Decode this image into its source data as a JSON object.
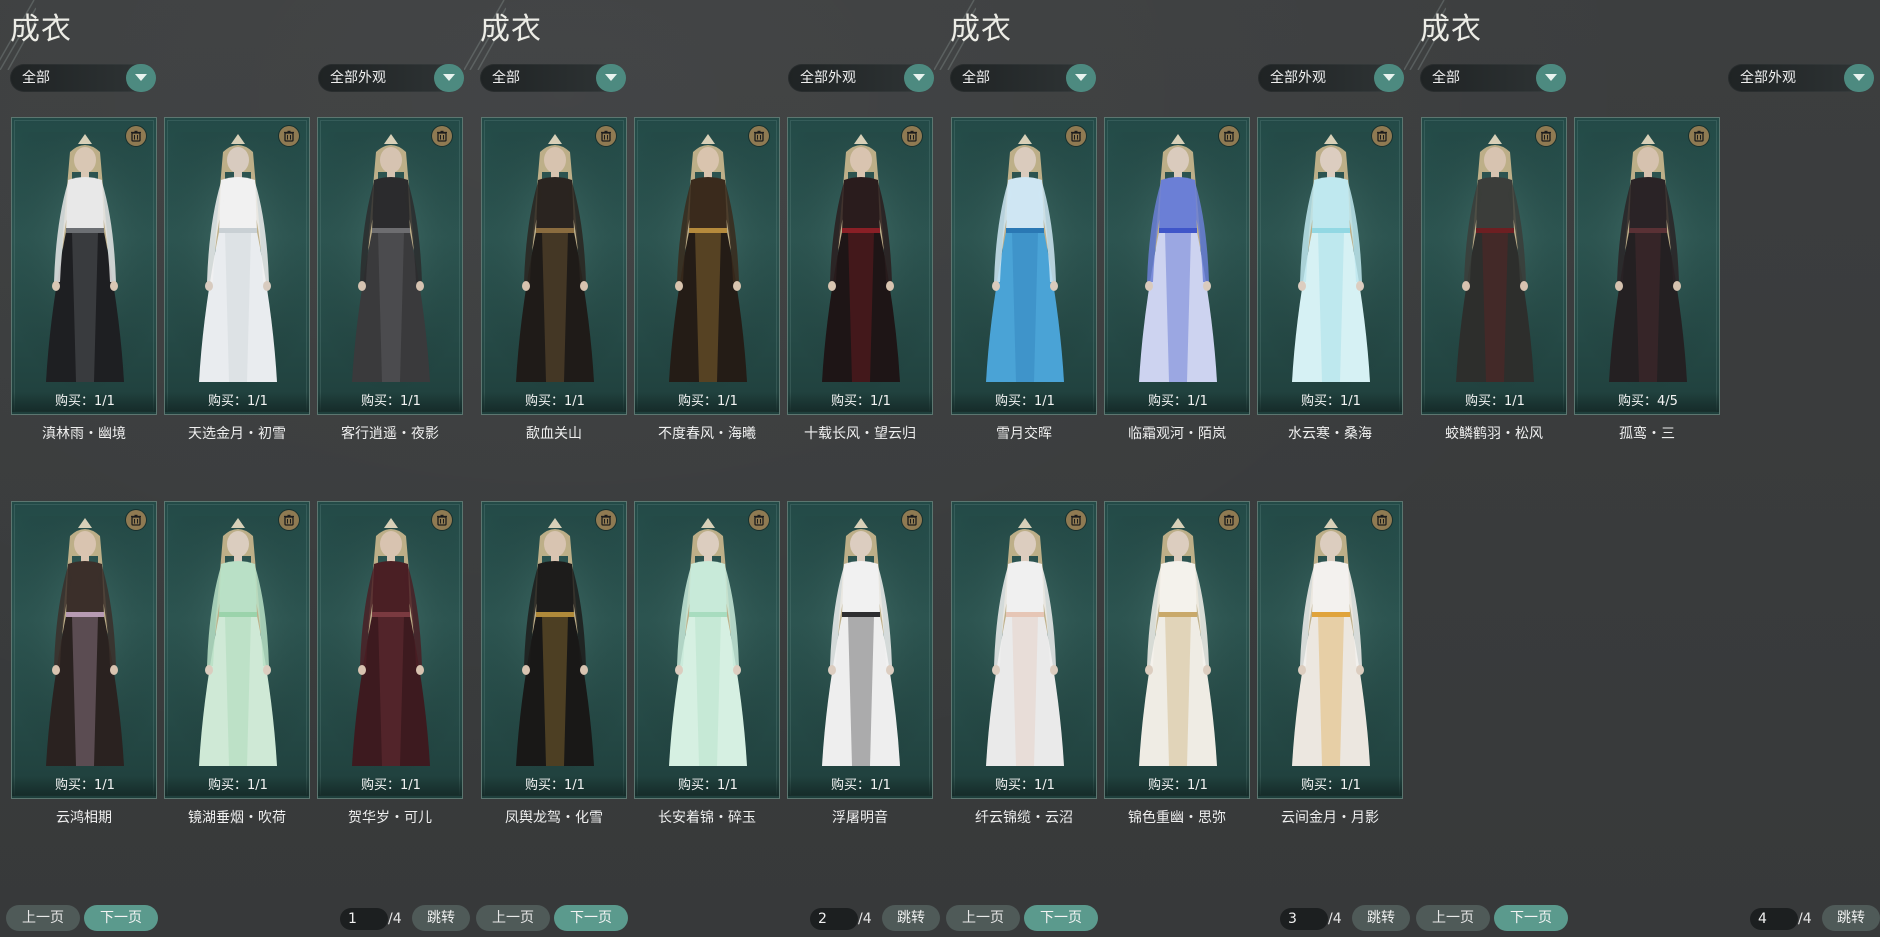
{
  "panels": [
    {
      "title": "成衣",
      "filter1": "全部",
      "filter2": "全部外观",
      "cards": [
        {
          "name": "滇林雨・幽境",
          "buy": "购买：1/1",
          "skin": "#d9c7b4",
          "top": "#e8e8e8",
          "dress": "#1e1f22",
          "accent": "#6c6f73"
        },
        {
          "name": "天选金月・初雪",
          "buy": "购买：1/1",
          "skin": "#d8cbbf",
          "top": "#f1f1f1",
          "dress": "#e9ecef",
          "accent": "#c9d0d4"
        },
        {
          "name": "客行逍遥・夜影",
          "buy": "购买：1/1",
          "skin": "#d6c3b1",
          "top": "#2b2b2d",
          "dress": "#3a3a3c",
          "accent": "#6d6d70"
        },
        {
          "name": "云鸿相期",
          "buy": "购买：1/1",
          "skin": "#d9c4b0",
          "top": "#3b2f2a",
          "dress": "#2a2220",
          "accent": "#b79bb3"
        },
        {
          "name": "镜湖垂烟・吹荷",
          "buy": "购买：1/1",
          "skin": "#dbcdbf",
          "top": "#b9e0c6",
          "dress": "#cfe9d6",
          "accent": "#9bd3ab"
        },
        {
          "name": "贺华岁・可儿",
          "buy": "购买：1/1",
          "skin": "#d8c3b0",
          "top": "#4a1f24",
          "dress": "#3d1a1f",
          "accent": "#7a3a40"
        }
      ],
      "prev": "上一页",
      "next": "下一页",
      "page": "1",
      "total": "/4",
      "jump": "跳转"
    },
    {
      "title": "成衣",
      "filter1": "全部",
      "filter2": "全部外观",
      "cards": [
        {
          "name": "歃血关山",
          "buy": "购买：1/1",
          "skin": "#d7c3af",
          "top": "#2a2420",
          "dress": "#1f1b18",
          "accent": "#8a6c3f"
        },
        {
          "name": "不度春风・海曦",
          "buy": "购买：1/1",
          "skin": "#d9c4ae",
          "top": "#3a2a1c",
          "dress": "#241c16",
          "accent": "#b58a3c"
        },
        {
          "name": "十载长风・望云归",
          "buy": "购买：1/1",
          "skin": "#d9c4b0",
          "top": "#2a1c1d",
          "dress": "#1e1516",
          "accent": "#8a1f26"
        },
        {
          "name": "凤舆龙驾・化雪",
          "buy": "购买：1/1",
          "skin": "#d8c4b1",
          "top": "#1d1c1b",
          "dress": "#191817",
          "accent": "#b08a3a"
        },
        {
          "name": "长安着锦・碎玉",
          "buy": "购买：1/1",
          "skin": "#dccdbf",
          "top": "#c8ead9",
          "dress": "#d6f0e2",
          "accent": "#a8dcbf"
        },
        {
          "name": "浮屠明音",
          "buy": "购买：1/1",
          "skin": "#dccdc0",
          "top": "#f1f1f1",
          "dress": "#eeeeee",
          "accent": "#2e2e30"
        }
      ],
      "prev": "上一页",
      "next": "下一页",
      "page": "2",
      "total": "/4",
      "jump": "跳转"
    },
    {
      "title": "成衣",
      "filter1": "全部",
      "filter2": "全部外观",
      "cards": [
        {
          "name": "雪月交晖",
          "buy": "购买：1/1",
          "skin": "#dacbbd",
          "top": "#cfe6f3",
          "dress": "#4aa3d6",
          "accent": "#2a78b4"
        },
        {
          "name": "临霜观河・陌岚",
          "buy": "购买：1/1",
          "skin": "#dacbbd",
          "top": "#6b7fd6",
          "dress": "#cdd3f0",
          "accent": "#3f55c9"
        },
        {
          "name": "水云寒・桑海",
          "buy": "购买：1/1",
          "skin": "#dccdc0",
          "top": "#bfe8ef",
          "dress": "#d6f1f4",
          "accent": "#92d8e3"
        },
        {
          "name": "纤云锦缆・云沼",
          "buy": "购买：1/1",
          "skin": "#dccdbf",
          "top": "#f0f0f0",
          "dress": "#eaeaea",
          "accent": "#e6c6b6"
        },
        {
          "name": "锦色重幽・思弥",
          "buy": "购买：1/1",
          "skin": "#dccdbf",
          "top": "#f4f2ec",
          "dress": "#efece4",
          "accent": "#c9a96a"
        },
        {
          "name": "云间金月・月影",
          "buy": "购买：1/1",
          "skin": "#dccdbf",
          "top": "#f3f1ee",
          "dress": "#ece7e0",
          "accent": "#e0a33a"
        }
      ],
      "prev": "上一页",
      "next": "下一页",
      "page": "3",
      "total": "/4",
      "jump": "跳转"
    },
    {
      "title": "成衣",
      "filter1": "全部",
      "filter2": "全部外观",
      "cards": [
        {
          "name": "蛟鳞鹤羽・松风",
          "buy": "购买：1/1",
          "skin": "#d7c3b0",
          "top": "#3b3d3a",
          "dress": "#2d2e2c",
          "accent": "#6d1f22"
        },
        {
          "name": "孤鸾・三",
          "buy": "购买：4/5",
          "skin": "#d6c2af",
          "top": "#2a2326",
          "dress": "#242022",
          "accent": "#5a3135"
        }
      ],
      "prev": "上一页",
      "next": "下一页",
      "page": "4",
      "total": "/4",
      "jump": "跳转"
    }
  ],
  "icons": {
    "trash": "trash-icon",
    "dropdown": "chevron-down-icon"
  },
  "colors": {
    "accent": "#5b9a8d",
    "card_border": "#5c7670",
    "trash_badge": "#8f7a52"
  }
}
